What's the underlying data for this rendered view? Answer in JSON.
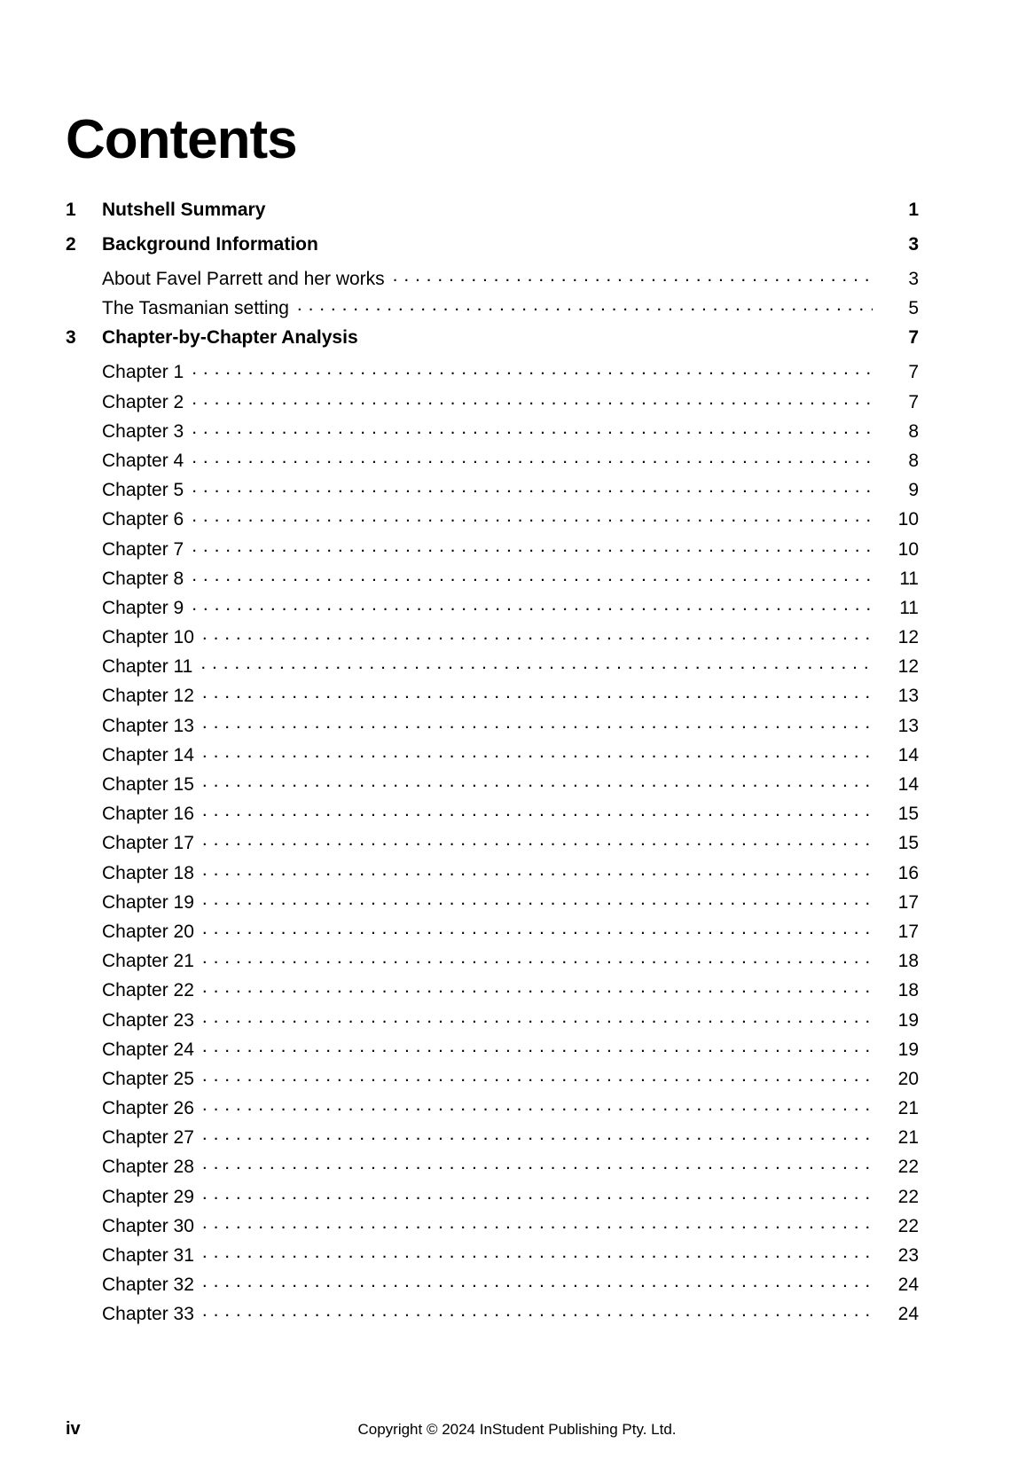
{
  "document": {
    "toc_title": "Contents"
  },
  "toc": {
    "entries": [
      {
        "type": "section",
        "number": "1",
        "label": "Nutshell Summary",
        "page": "1",
        "leader": false
      },
      {
        "type": "section",
        "number": "2",
        "label": "Background Information",
        "page": "3",
        "leader": false
      },
      {
        "type": "sub",
        "number": "",
        "label": "About Favel Parrett and her works",
        "page": "3",
        "leader": true
      },
      {
        "type": "sub",
        "number": "",
        "label": "The Tasmanian setting",
        "page": "5",
        "leader": true
      },
      {
        "type": "section",
        "number": "3",
        "label": "Chapter-by-Chapter Analysis",
        "page": "7",
        "leader": false
      },
      {
        "type": "sub",
        "number": "",
        "label": "Chapter 1",
        "page": "7",
        "leader": true
      },
      {
        "type": "sub",
        "number": "",
        "label": "Chapter 2",
        "page": "7",
        "leader": true
      },
      {
        "type": "sub",
        "number": "",
        "label": "Chapter 3",
        "page": "8",
        "leader": true
      },
      {
        "type": "sub",
        "number": "",
        "label": "Chapter 4",
        "page": "8",
        "leader": true
      },
      {
        "type": "sub",
        "number": "",
        "label": "Chapter 5",
        "page": "9",
        "leader": true
      },
      {
        "type": "sub",
        "number": "",
        "label": "Chapter 6",
        "page": "10",
        "leader": true
      },
      {
        "type": "sub",
        "number": "",
        "label": "Chapter 7",
        "page": "10",
        "leader": true
      },
      {
        "type": "sub",
        "number": "",
        "label": "Chapter 8",
        "page": "11",
        "leader": true
      },
      {
        "type": "sub",
        "number": "",
        "label": "Chapter 9",
        "page": "11",
        "leader": true
      },
      {
        "type": "sub",
        "number": "",
        "label": "Chapter 10",
        "page": "12",
        "leader": true
      },
      {
        "type": "sub",
        "number": "",
        "label": "Chapter 11",
        "page": "12",
        "leader": true
      },
      {
        "type": "sub",
        "number": "",
        "label": "Chapter 12",
        "page": "13",
        "leader": true
      },
      {
        "type": "sub",
        "number": "",
        "label": "Chapter 13",
        "page": "13",
        "leader": true
      },
      {
        "type": "sub",
        "number": "",
        "label": "Chapter 14",
        "page": "14",
        "leader": true
      },
      {
        "type": "sub",
        "number": "",
        "label": "Chapter 15",
        "page": "14",
        "leader": true
      },
      {
        "type": "sub",
        "number": "",
        "label": "Chapter 16",
        "page": "15",
        "leader": true
      },
      {
        "type": "sub",
        "number": "",
        "label": "Chapter 17",
        "page": "15",
        "leader": true
      },
      {
        "type": "sub",
        "number": "",
        "label": "Chapter 18",
        "page": "16",
        "leader": true
      },
      {
        "type": "sub",
        "number": "",
        "label": "Chapter 19",
        "page": "17",
        "leader": true
      },
      {
        "type": "sub",
        "number": "",
        "label": "Chapter 20",
        "page": "17",
        "leader": true
      },
      {
        "type": "sub",
        "number": "",
        "label": "Chapter 21",
        "page": "18",
        "leader": true
      },
      {
        "type": "sub",
        "number": "",
        "label": "Chapter 22",
        "page": "18",
        "leader": true
      },
      {
        "type": "sub",
        "number": "",
        "label": "Chapter 23",
        "page": "19",
        "leader": true
      },
      {
        "type": "sub",
        "number": "",
        "label": "Chapter 24",
        "page": "19",
        "leader": true
      },
      {
        "type": "sub",
        "number": "",
        "label": "Chapter 25",
        "page": "20",
        "leader": true
      },
      {
        "type": "sub",
        "number": "",
        "label": "Chapter 26",
        "page": "21",
        "leader": true
      },
      {
        "type": "sub",
        "number": "",
        "label": "Chapter 27",
        "page": "21",
        "leader": true
      },
      {
        "type": "sub",
        "number": "",
        "label": "Chapter 28",
        "page": "22",
        "leader": true
      },
      {
        "type": "sub",
        "number": "",
        "label": "Chapter 29",
        "page": "22",
        "leader": true
      },
      {
        "type": "sub",
        "number": "",
        "label": "Chapter 30",
        "page": "22",
        "leader": true
      },
      {
        "type": "sub",
        "number": "",
        "label": "Chapter 31",
        "page": "23",
        "leader": true
      },
      {
        "type": "sub",
        "number": "",
        "label": "Chapter 32",
        "page": "24",
        "leader": true
      },
      {
        "type": "sub",
        "number": "",
        "label": "Chapter 33",
        "page": "24",
        "leader": true
      }
    ]
  },
  "footer": {
    "folio": "iv",
    "copyright": "Copyright © 2024 InStudent Publishing Pty. Ltd."
  }
}
